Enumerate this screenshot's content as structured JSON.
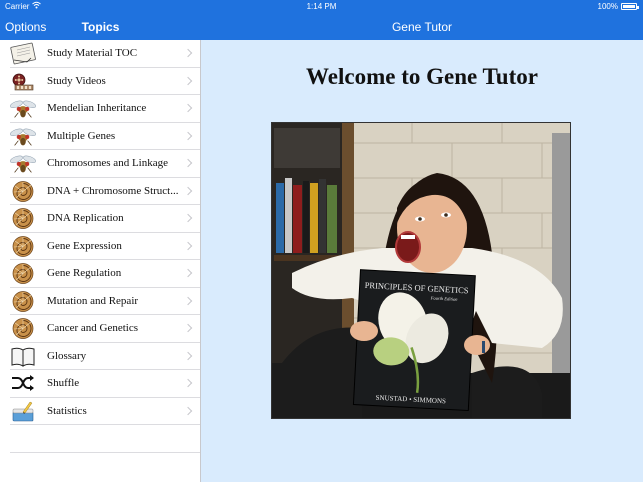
{
  "status_bar": {
    "carrier": "Carrier",
    "time": "1:14 PM",
    "battery": "100%"
  },
  "master_nav": {
    "options_label": "Options",
    "title": "Topics"
  },
  "detail_nav": {
    "title": "Gene Tutor"
  },
  "sidebar": {
    "items": [
      {
        "label": "Study Material TOC",
        "icon": "notebook-icon"
      },
      {
        "label": "Study Videos",
        "icon": "film-reel-icon"
      },
      {
        "label": "Mendelian Inheritance",
        "icon": "fruit-fly-icon"
      },
      {
        "label": "Multiple Genes",
        "icon": "fruit-fly-icon"
      },
      {
        "label": "Chromosomes and Linkage",
        "icon": "fruit-fly-icon"
      },
      {
        "label": "DNA + Chromosome Struct...",
        "icon": "nautilus-shell-icon"
      },
      {
        "label": "DNA Replication",
        "icon": "nautilus-shell-icon"
      },
      {
        "label": "Gene Expression",
        "icon": "nautilus-shell-icon"
      },
      {
        "label": "Gene Regulation",
        "icon": "nautilus-shell-icon"
      },
      {
        "label": "Mutation and Repair",
        "icon": "nautilus-shell-icon"
      },
      {
        "label": "Cancer and Genetics",
        "icon": "nautilus-shell-icon"
      },
      {
        "label": "Glossary",
        "icon": "open-book-icon"
      },
      {
        "label": "Shuffle",
        "icon": "shuffle-icon"
      },
      {
        "label": "Statistics",
        "icon": "stats-cards-icon"
      }
    ]
  },
  "main": {
    "welcome": "Welcome to Gene Tutor",
    "book": {
      "title": "PRINCIPLES OF GENETICS",
      "edition": "Fourth Edition",
      "authors": "SNUSTAD • SIMMONS"
    }
  },
  "colors": {
    "nav_blue": "#1f72de",
    "detail_background": "#d9ebfd"
  }
}
